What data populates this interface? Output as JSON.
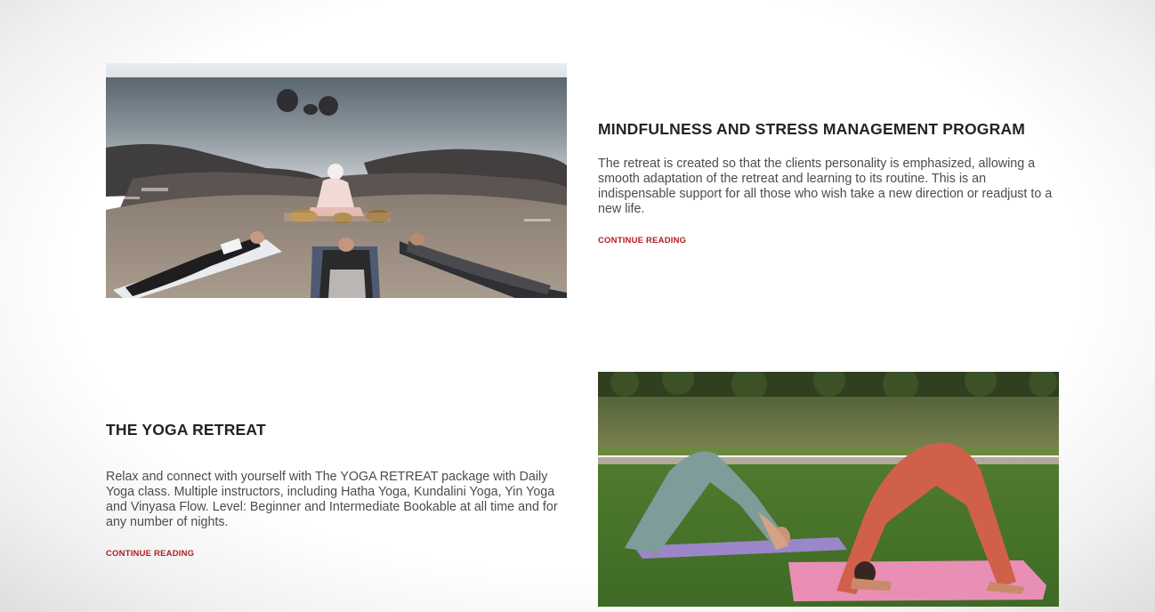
{
  "posts": [
    {
      "title": "MINDFULNESS AND STRESS MANAGEMENT PROGRAM",
      "excerpt": "The retreat is created so that the clients personality is emphasized, allowing a smooth adaptation of the retreat and learning to its routine. This is an indispensable support for all those who wish take a new direction or readjust to a new life.",
      "link_label": "CONTINUE READING",
      "image": "beach-meditation-photo"
    },
    {
      "title": "THE YOGA RETREAT",
      "excerpt": "Relax and connect with yourself with The YOGA RETREAT package with Daily Yoga class. Multiple instructors, including Hatha Yoga, Kundalini Yoga, Yin Yoga and Vinyasa Flow. Level: Beginner and Intermediate Bookable at all time and for any number of nights.",
      "link_label": "CONTINUE READING",
      "image": "park-yoga-photo"
    }
  ],
  "colors": {
    "accent_link": "#b01e23",
    "title": "#232323",
    "body_text": "#4c4c4c"
  }
}
